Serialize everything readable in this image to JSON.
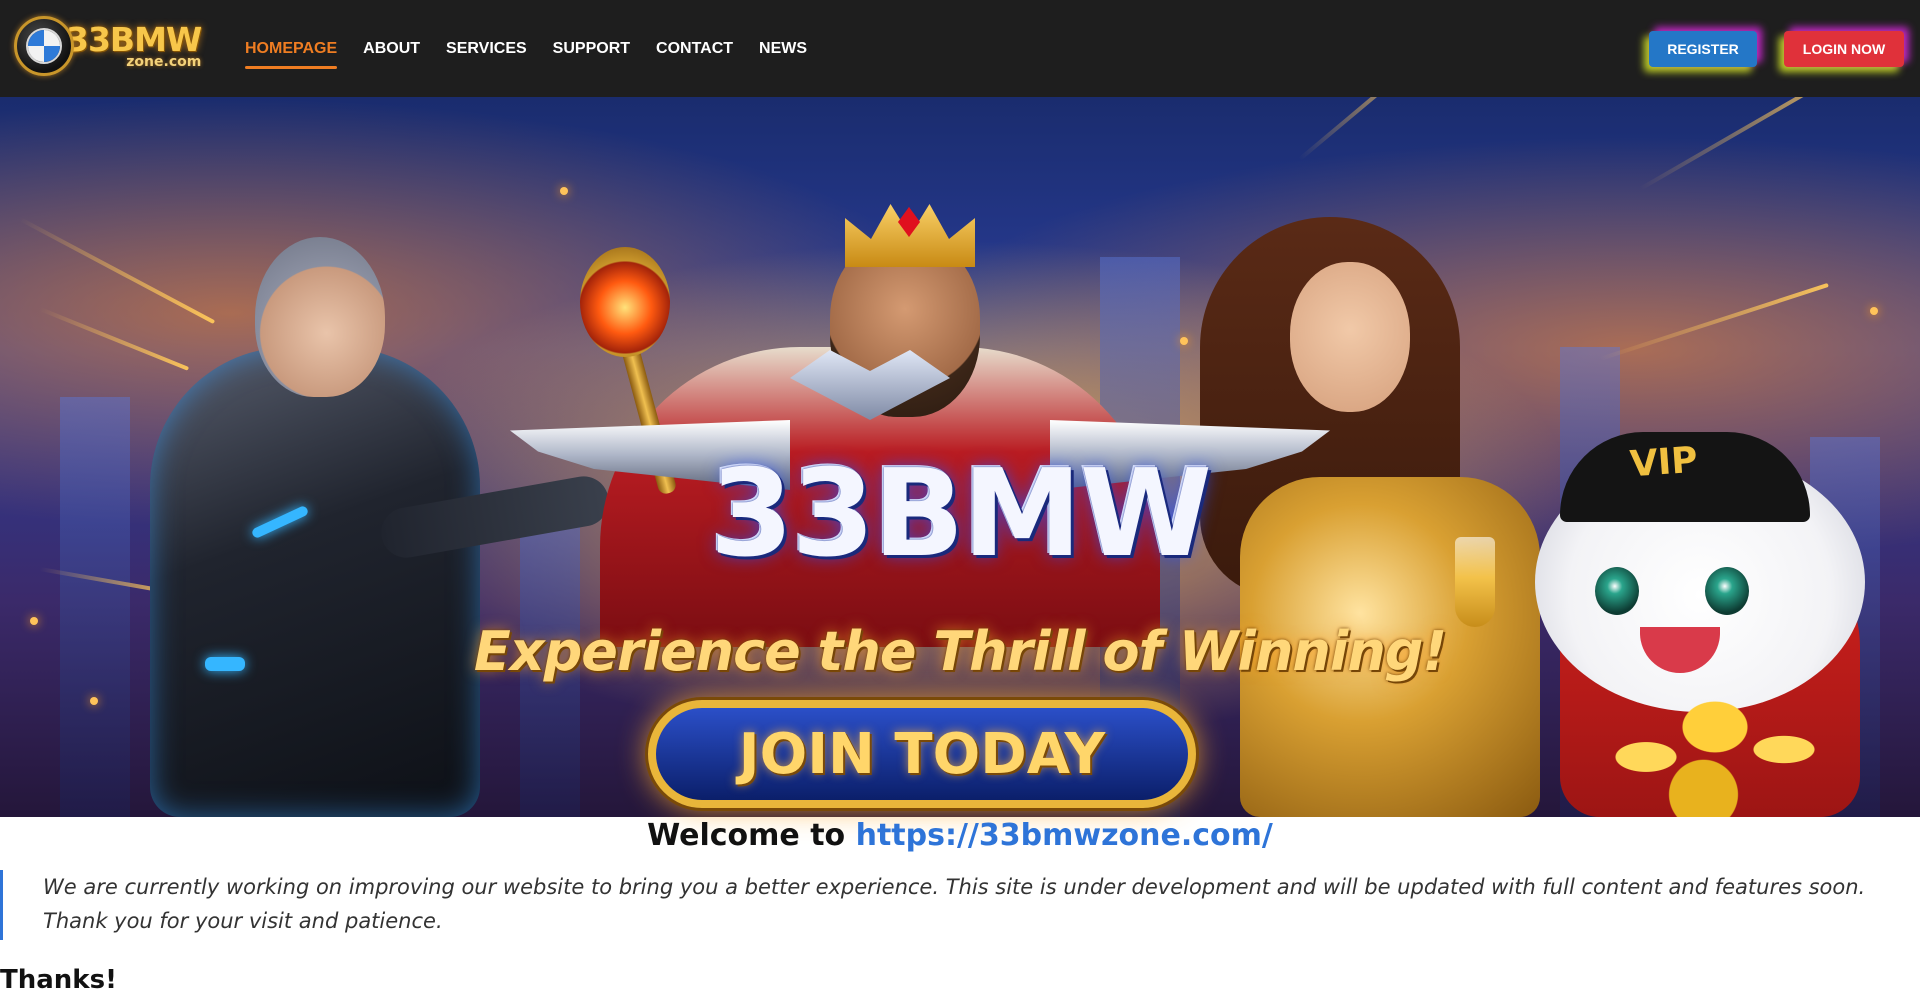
{
  "header": {
    "logo": {
      "main": "33BMW",
      "sub": "zone.com"
    },
    "nav": [
      {
        "label": "HOMEPAGE",
        "active": true
      },
      {
        "label": "ABOUT",
        "active": false
      },
      {
        "label": "SERVICES",
        "active": false
      },
      {
        "label": "SUPPORT",
        "active": false
      },
      {
        "label": "CONTACT",
        "active": false
      },
      {
        "label": "NEWS",
        "active": false
      }
    ],
    "register_label": "REGISTER",
    "login_label": "LOGIN NOW"
  },
  "banner": {
    "brand": "33BMW",
    "tagline": "Experience the Thrill of Winning!",
    "cta": "JOIN TODAY",
    "cap_text": "VIP"
  },
  "content": {
    "welcome_prefix": "Welcome to",
    "welcome_link": "https://33bmwzone.com/",
    "notice": "We are currently working on improving our website to bring you a better experience. This site is under development and will be updated with full content and features soon. Thank you for your visit and patience.",
    "thanks": "Thanks!"
  },
  "colors": {
    "header_bg": "#1e1e1e",
    "nav_active": "#ef7d22",
    "register_bg": "#2477c7",
    "login_bg": "#e0313a",
    "link": "#2e74d8"
  }
}
